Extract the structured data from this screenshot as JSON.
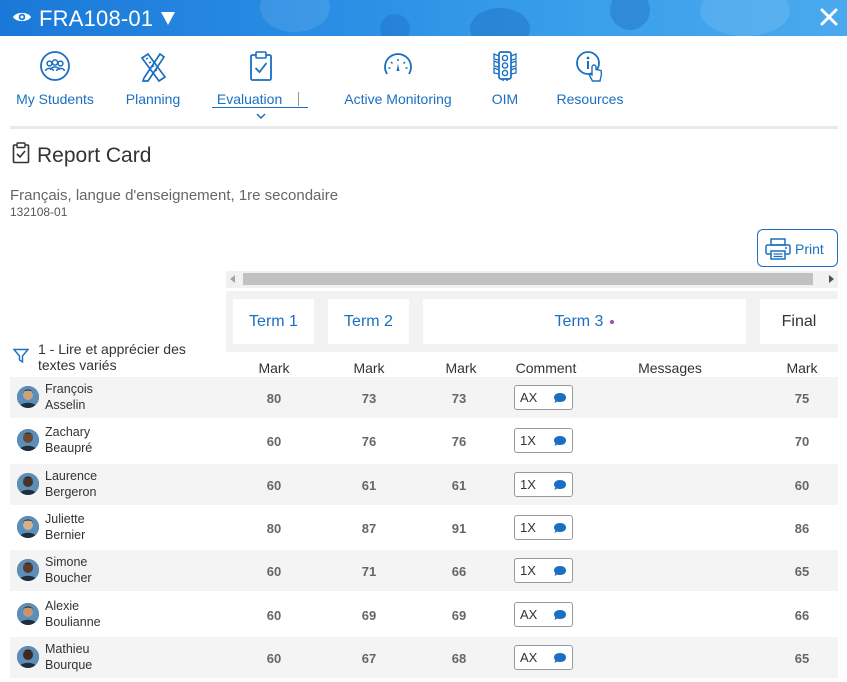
{
  "header": {
    "class_code": "FRA108-01"
  },
  "nav": {
    "items": [
      {
        "label": "My Students",
        "icon": "students-icon"
      },
      {
        "label": "Planning",
        "icon": "planning-icon"
      },
      {
        "label": "Evaluation",
        "icon": "evaluation-clipboard-icon"
      },
      {
        "label": "Active Monitoring",
        "icon": "gauge-icon"
      },
      {
        "label": "OIM",
        "icon": "traffic-light-icon"
      },
      {
        "label": "Resources",
        "icon": "info-touch-icon"
      }
    ],
    "active": "Evaluation"
  },
  "page": {
    "title": "Report Card",
    "course_name": "Français, langue d'enseignement, 1re secondaire",
    "course_code": "132108-01",
    "print_label": "Print"
  },
  "terms": {
    "term1": "Term 1",
    "term2": "Term 2",
    "term3": "Term 3",
    "final": "Final"
  },
  "competency": "1 - Lire et apprécier des textes variés",
  "columns": {
    "mark": "Mark",
    "comment": "Comment",
    "messages": "Messages"
  },
  "students": [
    {
      "first": "François",
      "last": "Asselin",
      "t1": "80",
      "t2": "73",
      "t3": "73",
      "comment": "AX",
      "final": "75"
    },
    {
      "first": "Zachary",
      "last": "Beaupré",
      "t1": "60",
      "t2": "76",
      "t3": "76",
      "comment": "1X",
      "final": "70"
    },
    {
      "first": "Laurence",
      "last": "Bergeron",
      "t1": "60",
      "t2": "61",
      "t3": "61",
      "comment": "1X",
      "final": "60"
    },
    {
      "first": "Juliette",
      "last": "Bernier",
      "t1": "80",
      "t2": "87",
      "t3": "91",
      "comment": "1X",
      "final": "86"
    },
    {
      "first": "Simone",
      "last": "Boucher",
      "t1": "60",
      "t2": "71",
      "t3": "66",
      "comment": "1X",
      "final": "65"
    },
    {
      "first": "Alexie",
      "last": "Boulianne",
      "t1": "60",
      "t2": "69",
      "t3": "69",
      "comment": "AX",
      "final": "66"
    },
    {
      "first": "Mathieu",
      "last": "Bourque",
      "t1": "60",
      "t2": "67",
      "t3": "68",
      "comment": "AX",
      "final": "65"
    }
  ],
  "colors": {
    "brand_blue": "#1a6fc1",
    "header_blue": "#1a78d8",
    "term3_dot": "#a04ab5",
    "comment_icon": "#1a6fc1"
  }
}
